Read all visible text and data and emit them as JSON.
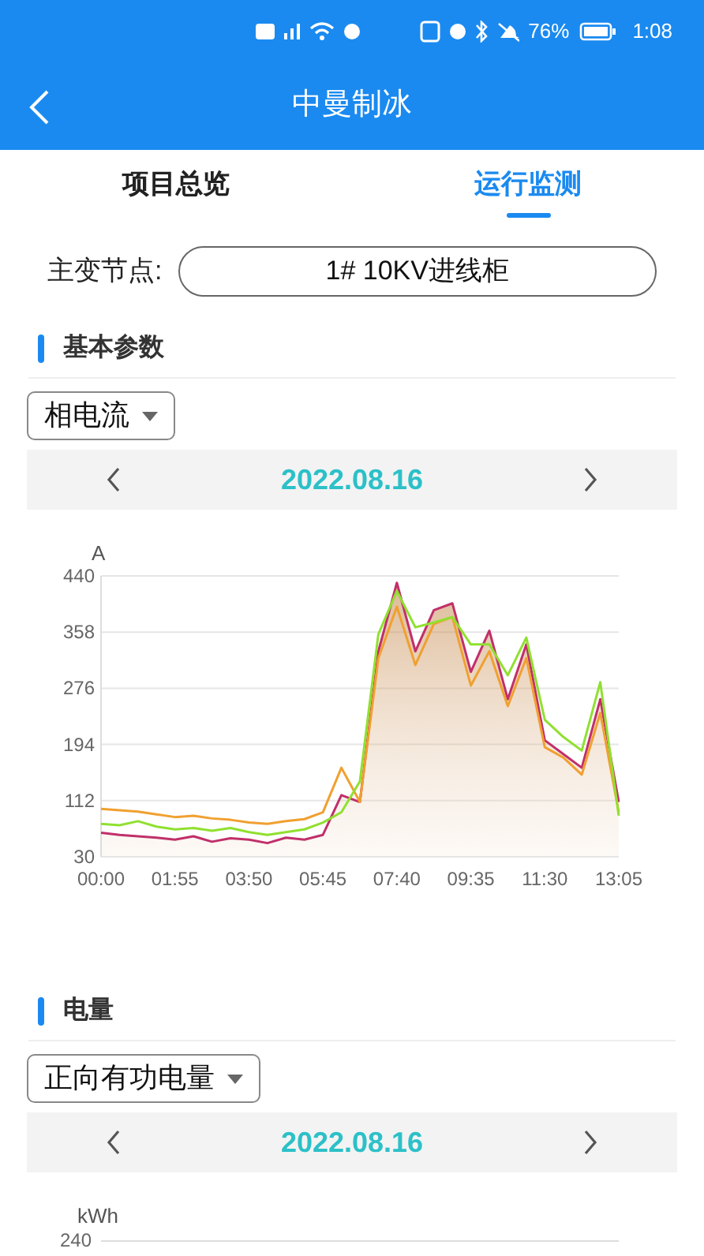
{
  "status_bar": {
    "battery": "76%",
    "time": "1:08"
  },
  "app_bar": {
    "title": "中曼制冰"
  },
  "tabs": [
    {
      "label": "项目总览",
      "selected": false
    },
    {
      "label": "运行监测",
      "selected": true
    }
  ],
  "node": {
    "label": "主变节点:",
    "value": "1# 10KV进线柜"
  },
  "sections": [
    {
      "title": "基本参数",
      "dropdown": "相电流",
      "date": "2022.08.16",
      "chart_data": {
        "type": "line",
        "grid": true,
        "ylabel": "A",
        "categories": [
          "00:00",
          null,
          null,
          null,
          "01:55",
          null,
          null,
          null,
          "03:50",
          null,
          null,
          null,
          "05:45",
          null,
          null,
          null,
          "07:40",
          null,
          null,
          null,
          "09:35",
          null,
          null,
          null,
          "11:30",
          null,
          null,
          null,
          "13:05"
        ],
        "yticks": [
          30,
          112,
          194,
          276,
          358,
          440
        ],
        "ylim": [
          30,
          440
        ],
        "series": [
          {
            "type": "line",
            "color": "#f0a030",
            "values": [
              100,
              98,
              96,
              92,
              88,
              90,
              86,
              84,
              80,
              78,
              82,
              85,
              95,
              160,
              110,
              320,
              395,
              310,
              370,
              380,
              280,
              330,
              250,
              320,
              190,
              175,
              150,
              240,
              95
            ]
          },
          {
            "type": "line",
            "color": "#90e030",
            "values": [
              78,
              76,
              82,
              74,
              70,
              72,
              68,
              72,
              66,
              62,
              66,
              70,
              80,
              95,
              140,
              355,
              418,
              365,
              372,
              380,
              340,
              340,
              295,
              350,
              230,
              205,
              185,
              285,
              90
            ]
          },
          {
            "type": "area",
            "color": "#c0306a",
            "values": [
              65,
              62,
              60,
              58,
              55,
              60,
              52,
              57,
              55,
              50,
              58,
              55,
              62,
              120,
              110,
              330,
              430,
              330,
              390,
              400,
              300,
              360,
              260,
              340,
              200,
              180,
              160,
              260,
              110
            ]
          }
        ]
      }
    },
    {
      "title": "电量",
      "dropdown": "正向有功电量",
      "date": "2022.08.16",
      "unit": "kWh",
      "top_tick": "240"
    }
  ]
}
